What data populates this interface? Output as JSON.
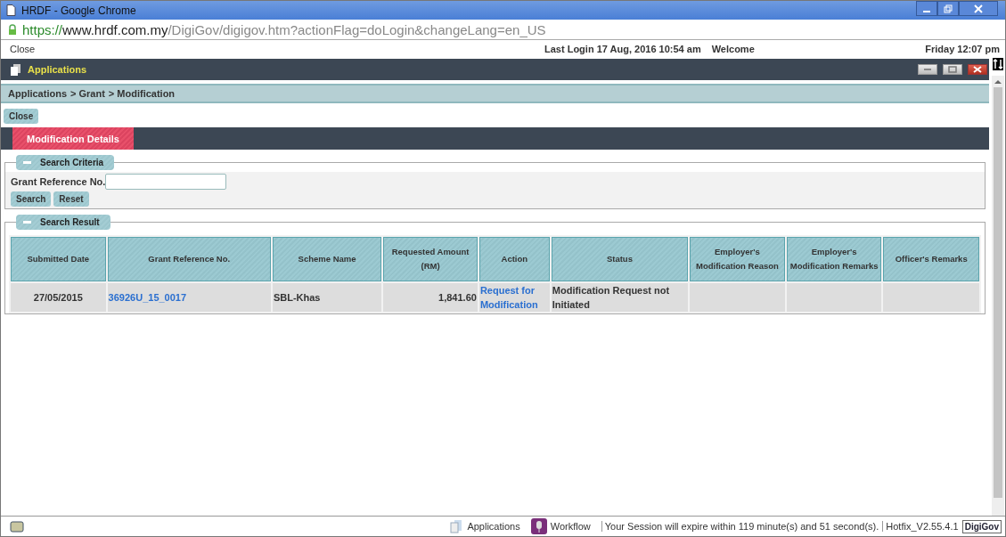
{
  "window": {
    "title": "HRDF - Google Chrome"
  },
  "address_bar": {
    "scheme": "https://",
    "host": "www.hrdf.com.my",
    "path": "/DigiGov/digigov.htm?actionFlag=doLogin&changeLang=en_US"
  },
  "top_bar": {
    "close": "Close",
    "last_login": "Last Login 17 Aug, 2016 10:54 am",
    "welcome": "Welcome",
    "datetime": "Friday 12:07 pm"
  },
  "app_bar": {
    "title": "Applications"
  },
  "breadcrumb": [
    "Applications",
    "> Grant",
    "> Modification"
  ],
  "close_button": "Close",
  "tabs": [
    {
      "label": "Modification Details",
      "selected": true
    }
  ],
  "search_criteria": {
    "legend": "Search Criteria",
    "field_label": "Grant Reference No.",
    "buttons": [
      "Search",
      "Reset"
    ]
  },
  "search_result": {
    "legend": "Search Result",
    "columns": [
      "Submitted Date",
      "Grant Reference No.",
      "Scheme Name",
      "Requested Amount (RM)",
      "Action",
      "Status",
      "Employer's Modification Reason",
      "Employer's Modification Remarks",
      "Officer's Remarks"
    ],
    "rows": [
      {
        "submitted_date": "27/05/2015",
        "grant_reference": "36926U_15_0017",
        "scheme_name": "SBL-Khas",
        "requested_amount": "1,841.60",
        "action": "Request for Modification",
        "status": "Modification Request not Initiated"
      }
    ]
  },
  "status_bar": {
    "applications": "Applications",
    "workflow": "Workflow",
    "session": "Your Session will expire within 119 minute(s) and 51 second(s).",
    "version": "Hotfix_V2.55.4.1",
    "logo": "DigiGov"
  }
}
